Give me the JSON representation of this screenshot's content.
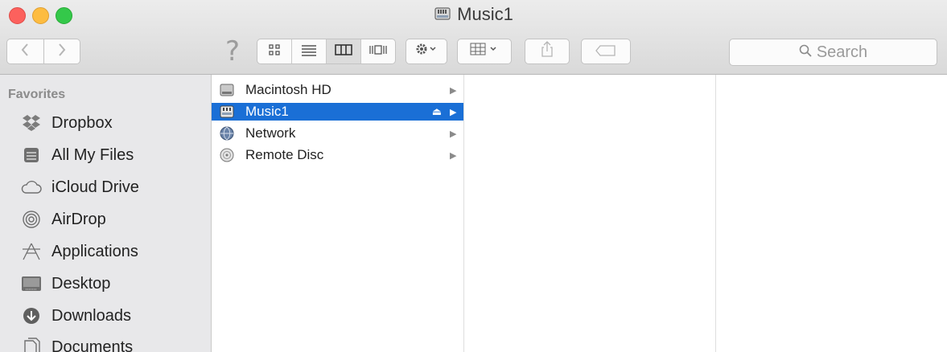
{
  "window": {
    "title": "Music1"
  },
  "toolbar": {
    "back_icon": "chevron-left-icon",
    "forward_icon": "chevron-right-icon",
    "help_glyph": "?",
    "view_modes": [
      "icon-view-icon",
      "list-view-icon",
      "column-view-icon",
      "cover-flow-icon"
    ],
    "active_view": "column",
    "action_icon": "gear-icon",
    "arrange_icon": "grid-arrange-icon",
    "share_icon": "share-icon",
    "tag_icon": "tag-icon",
    "search_placeholder": "Search"
  },
  "sidebar": {
    "section_title": "Favorites",
    "items": [
      {
        "label": "Dropbox",
        "icon": "dropbox-icon"
      },
      {
        "label": "All My Files",
        "icon": "all-files-icon"
      },
      {
        "label": "iCloud Drive",
        "icon": "cloud-icon"
      },
      {
        "label": "AirDrop",
        "icon": "airdrop-icon"
      },
      {
        "label": "Applications",
        "icon": "applications-icon"
      },
      {
        "label": "Desktop",
        "icon": "desktop-icon"
      },
      {
        "label": "Downloads",
        "icon": "downloads-icon"
      },
      {
        "label": "Documents",
        "icon": "documents-icon"
      }
    ]
  },
  "column1": {
    "items": [
      {
        "label": "Macintosh HD",
        "icon": "hard-drive-icon",
        "selected": false
      },
      {
        "label": "Music1",
        "icon": "external-drive-icon",
        "selected": true
      },
      {
        "label": "Network",
        "icon": "network-globe-icon",
        "selected": false
      },
      {
        "label": "Remote Disc",
        "icon": "disc-icon",
        "selected": false
      }
    ]
  },
  "colors": {
    "selection": "#1a6fd6",
    "close": "#fc615d",
    "minimize": "#fdbc40",
    "zoom": "#34c84a"
  }
}
